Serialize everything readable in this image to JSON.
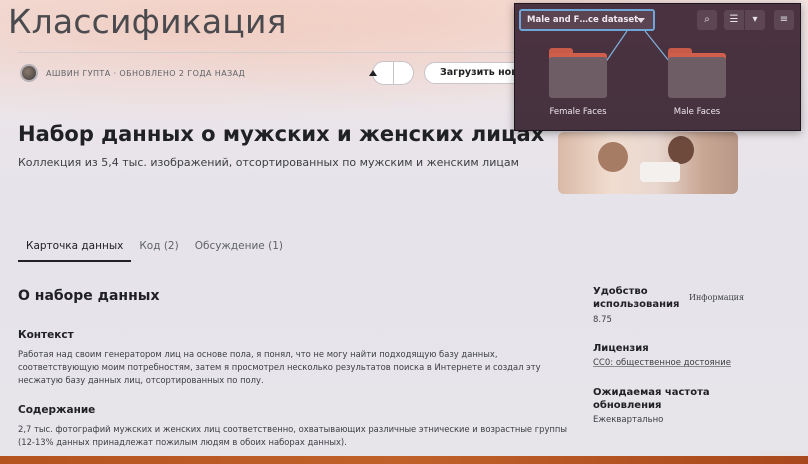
{
  "page": {
    "title": "Классификация",
    "author_line": "АШВИН ГУПТА · ОБНОВЛЕНО 2 ГОДА НАЗАД",
    "download_label": "Загрузить новый",
    "dataset_title": "Набор данных о мужских и женских лицах",
    "dataset_subtitle": "Коллекция из 5,4 тыс. изображений, отсортированных по мужским и женским лицам"
  },
  "tabs": [
    {
      "label": "Карточка данных",
      "active": true
    },
    {
      "label": "Код (2)",
      "active": false
    },
    {
      "label": "Обсуждение (1)",
      "active": false
    }
  ],
  "about": {
    "heading": "О наборе данных",
    "context_heading": "Контекст",
    "context_text": "Работая над своим генератором лиц на основе пола, я понял, что не могу найти подходящую базу данных, соответствующую моим потребностям, затем я просмотрел несколько результатов поиска в Интернете и создал эту несжатую базу данных лиц, отсортированных по полу.",
    "content_heading": "Содержание",
    "content_text": "2,7 тыс. фотографий мужских и женских лиц соответственно, охватывающих различные этнические и возрастные группы (12-13% данных принадлежат пожилым людям в обоих наборах данных)."
  },
  "sidebar": {
    "usability_label": "Удобство использования",
    "usability_info": "Информация",
    "usability_value": "8.75",
    "license_label": "Лицензия",
    "license_value": "CC0: общественное достояние",
    "frequency_label": "Ожидаемая частота обновления",
    "frequency_value": "Ежеквартально"
  },
  "popup": {
    "crumb_label": "Male and F…ce dataset",
    "folders": [
      {
        "name": "Female Faces"
      },
      {
        "name": "Male Faces"
      }
    ],
    "buttons": [
      {
        "icon": "search-icon",
        "glyph": "⌕"
      },
      {
        "icon": "list-view-icon",
        "glyph": "☰"
      },
      {
        "icon": "chevron-down-icon",
        "glyph": "▾"
      },
      {
        "icon": "hamburger-menu-icon",
        "glyph": "≡"
      }
    ]
  },
  "colors": {
    "popup_bg": "#46323f",
    "crumb_border": "#6fa6d8",
    "folder_tab": "#d15d4b",
    "bottom_bar": "#b5531f"
  }
}
